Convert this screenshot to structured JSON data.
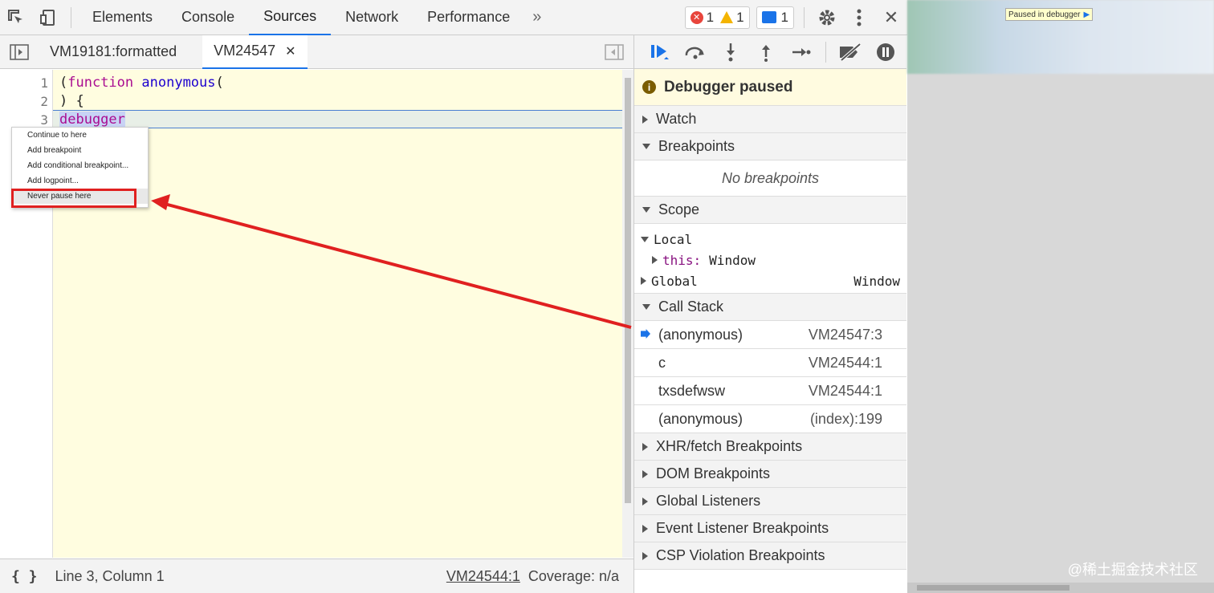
{
  "toolbar": {
    "tabs": [
      "Elements",
      "Console",
      "Sources",
      "Network",
      "Performance"
    ],
    "more": "»",
    "errors": "1",
    "warnings": "1",
    "messages": "1",
    "close": "✕"
  },
  "file_tabs": {
    "tab1": "VM19181:formatted",
    "tab2": "VM24547",
    "tab2_close": "✕"
  },
  "editor": {
    "lines": [
      {
        "num": "1",
        "text": "(function anonymous("
      },
      {
        "num": "2",
        "text": ") {"
      },
      {
        "num": "3",
        "text": "debugger"
      }
    ]
  },
  "context_menu": {
    "items": [
      "Continue to here",
      "Add breakpoint",
      "Add conditional breakpoint...",
      "Add logpoint...",
      "Never pause here"
    ]
  },
  "statusbar": {
    "braces": "{ }",
    "position": "Line 3, Column 1",
    "source_link": "VM24544:1",
    "coverage": "Coverage: n/a"
  },
  "debugger": {
    "paused_title": "Debugger paused",
    "sections": {
      "watch": "Watch",
      "breakpoints": "Breakpoints",
      "no_breakpoints": "No breakpoints",
      "scope": "Scope",
      "call_stack": "Call Stack",
      "xhr": "XHR/fetch Breakpoints",
      "dom": "DOM Breakpoints",
      "global_listeners": "Global Listeners",
      "event_listener": "Event Listener Breakpoints",
      "csp": "CSP Violation Breakpoints"
    },
    "scope": {
      "local": "Local",
      "this_key": "this:",
      "this_val": "Window",
      "global": "Global",
      "global_val": "Window"
    },
    "call_stack": [
      {
        "name": "(anonymous)",
        "loc": "VM24547:3"
      },
      {
        "name": "c",
        "loc": "VM24544:1"
      },
      {
        "name": "txsdefwsw",
        "loc": "VM24544:1"
      },
      {
        "name": "(anonymous)",
        "loc": "(index):199"
      }
    ]
  },
  "preview": {
    "paused_overlay": "Paused in debugger",
    "watermark": "@稀土掘金技术社区"
  },
  "colors": {
    "accent": "#1a73e8",
    "annotation_red": "#e02020",
    "editor_bg": "#fffde0"
  }
}
